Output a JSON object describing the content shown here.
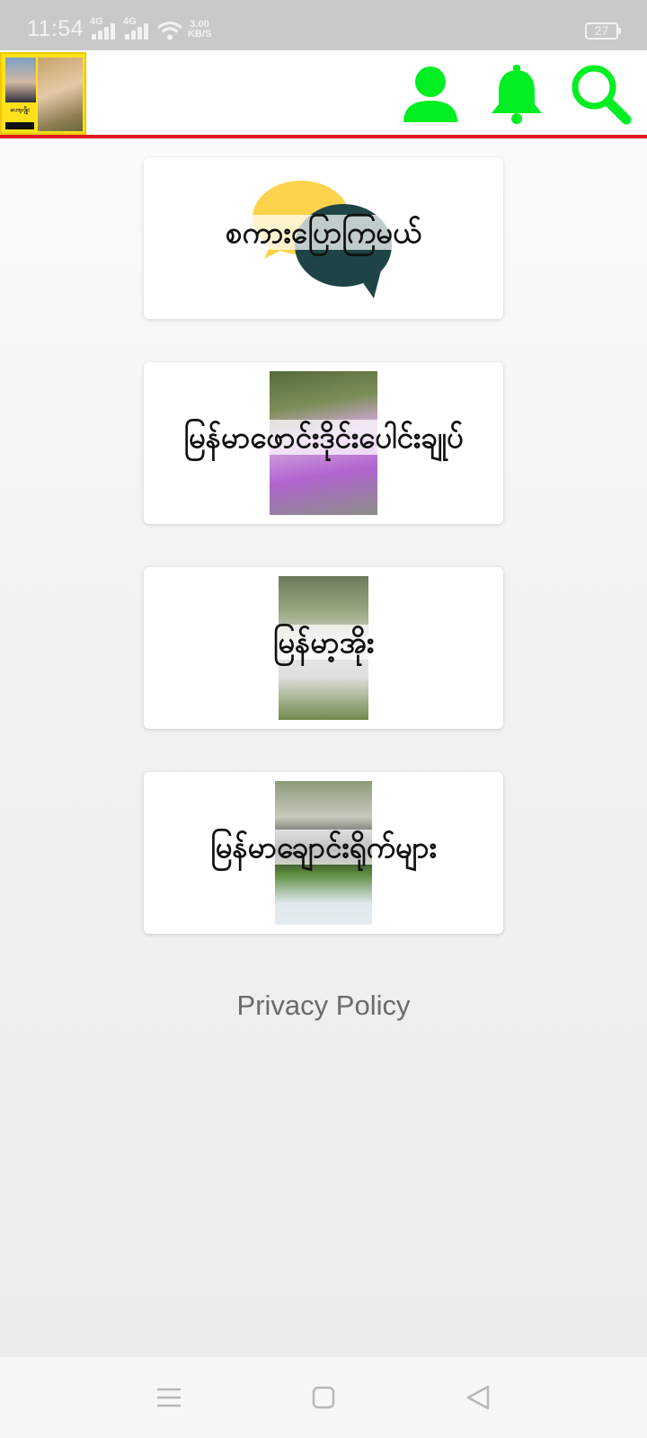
{
  "status_bar": {
    "time": "11:54",
    "network_a": "4G",
    "network_b": "4G",
    "speed_value": "3.00",
    "speed_unit": "KB/S",
    "battery": "27"
  },
  "app_bar": {
    "logo_text": "ဟော့ဂျိုး",
    "accent_color": "#00ee22",
    "divider_color": "#e0191c"
  },
  "cards": [
    {
      "label": "စကားပြောကြမယ်"
    },
    {
      "label": "မြန်မာဖောင်းဒိုင်းပေါင်းချုပ်"
    },
    {
      "label": "မြန်မာ့အိုး"
    },
    {
      "label": "မြန်မာချောင်းရိုက်များ"
    }
  ],
  "footer": {
    "privacy_label": "Privacy Policy"
  },
  "icons": {
    "profile": "person-icon",
    "notifications": "bell-icon",
    "search": "search-icon",
    "menu": "menu-icon",
    "home": "home-icon",
    "back": "back-icon"
  }
}
